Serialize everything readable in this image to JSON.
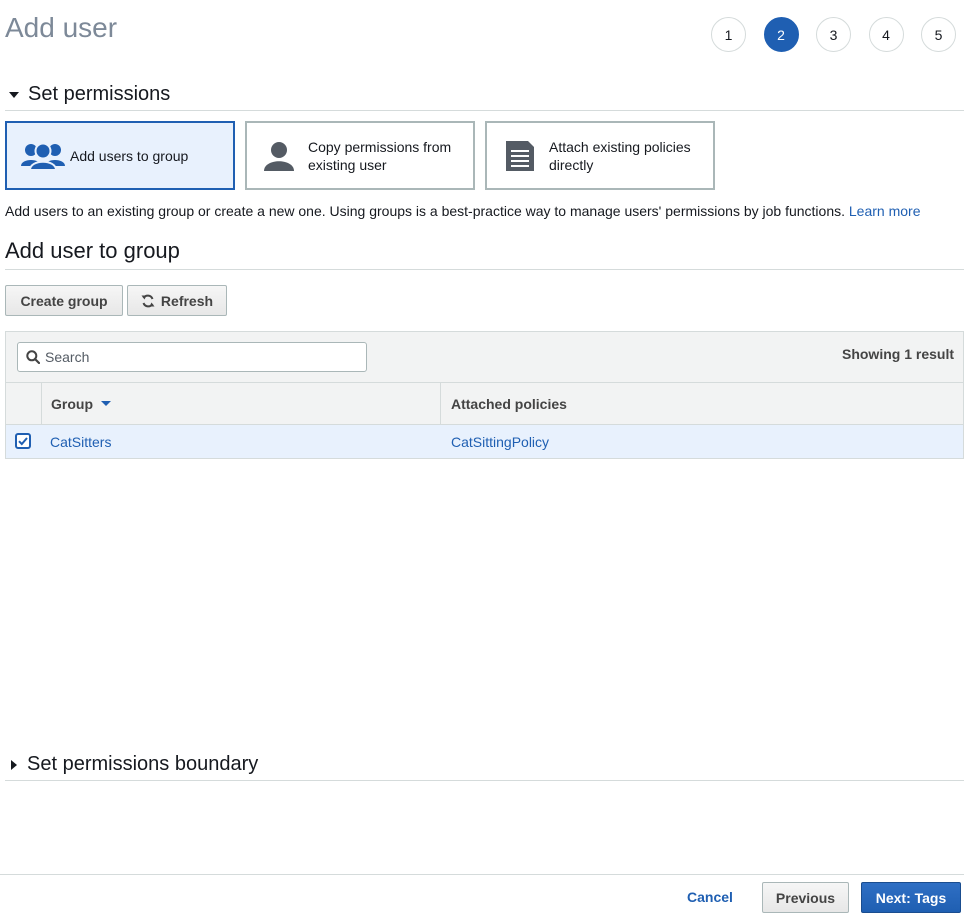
{
  "header": {
    "title": "Add user"
  },
  "steps": [
    "1",
    "2",
    "3",
    "4",
    "5"
  ],
  "active_step": "2",
  "permissions": {
    "section_title": "Set permissions",
    "options": [
      {
        "label": "Add users to group",
        "icon": "users-group-icon",
        "selected": true
      },
      {
        "label_line1": "Copy permissions from",
        "label_line2": "existing user",
        "icon": "user-icon",
        "selected": false
      },
      {
        "label_line1": "Attach existing policies",
        "label_line2": "directly",
        "icon": "document-icon",
        "selected": false
      }
    ],
    "description": "Add users to an existing group or create a new one. Using groups is a best-practice way to manage users' permissions by job functions.",
    "learn_more": "Learn more"
  },
  "group_section": {
    "title": "Add user to group",
    "create_group_label": "Create group",
    "refresh_label": "Refresh",
    "search_placeholder": "Search",
    "showing_text": "Showing 1 result",
    "columns": {
      "group": "Group",
      "policies": "Attached policies"
    },
    "rows": [
      {
        "group": "CatSitters",
        "policies": "CatSittingPolicy",
        "checked": true
      }
    ]
  },
  "boundary": {
    "section_title": "Set permissions boundary"
  },
  "footer": {
    "cancel": "Cancel",
    "previous": "Previous",
    "next": "Next: Tags"
  },
  "colors": {
    "accent": "#1f5fb2",
    "selected_bg": "#e8f1fd",
    "border": "#aab7b8",
    "muted_title": "#7d8998"
  }
}
